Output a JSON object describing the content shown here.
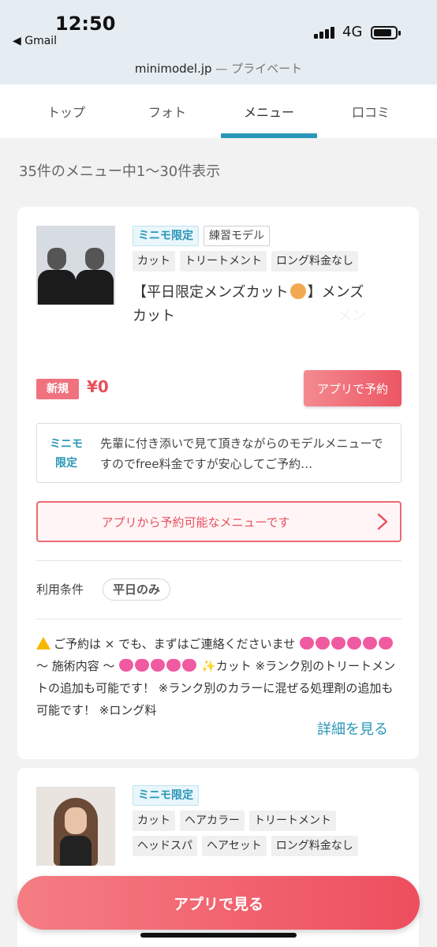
{
  "status_bar": {
    "time": "12:50",
    "back_app": "◀ Gmail",
    "network": "4G"
  },
  "url_bar": {
    "domain": "minimodel.jp",
    "suffix": " — プライベート"
  },
  "tabs": [
    {
      "label": "トップ"
    },
    {
      "label": "フォト"
    },
    {
      "label": "メニュー"
    },
    {
      "label": "口コミ"
    }
  ],
  "active_tab": "メニュー",
  "result_count": "35件のメニュー中1〜30件表示",
  "menu_items": [
    {
      "tags_row1": [
        "ミニモ限定",
        "練習モデル"
      ],
      "tags_row2": [
        "カット",
        "トリートメント",
        "ロング料金なし"
      ],
      "title_line1_pre": "【平日限定メンズカット",
      "title_line1_post": "】メンズ",
      "title_line2": "カット",
      "title_ghost_right": "メン",
      "new_badge": "新規",
      "price": "¥0",
      "reserve_button": "アプリで予約",
      "minimo_label": "ミニモ限定",
      "minimo_text": "先輩に付き添いで見て頂きながらのモデルメニューですのでfree料金ですが安心してご予約…",
      "app_only_notice": "アプリから予約可能なメニューです",
      "condition_label": "利用条件",
      "condition_value": "平日のみ",
      "description_1": "ご予約は × でも、まずはご連絡くださいませ",
      "description_2": "〜 施術内容 〜",
      "description_3": "✨カット ※ランク別のトリートメントの追加も可能です！ ※ランク別のカラーに混ぜる処理剤の追加も可能です！ ※ロング料",
      "more_link": "詳細を見る"
    },
    {
      "tags_row1": [
        "ミニモ限定"
      ],
      "tags_row2": [
        "カット",
        "ヘアカラー",
        "トリートメント"
      ],
      "tags_row3": [
        "ヘッドスパ",
        "ヘアセット",
        "ロング料金なし"
      ]
    }
  ],
  "floating_button": "アプリで見る",
  "colors": {
    "accent": "#2a96b8",
    "brand_pink": "#ec5664",
    "price_red": "#e8505c"
  },
  "icons": [
    "back-arrow-icon",
    "signal-icon",
    "battery-icon",
    "chevron-right-icon",
    "warning-icon",
    "heart-icon"
  ]
}
